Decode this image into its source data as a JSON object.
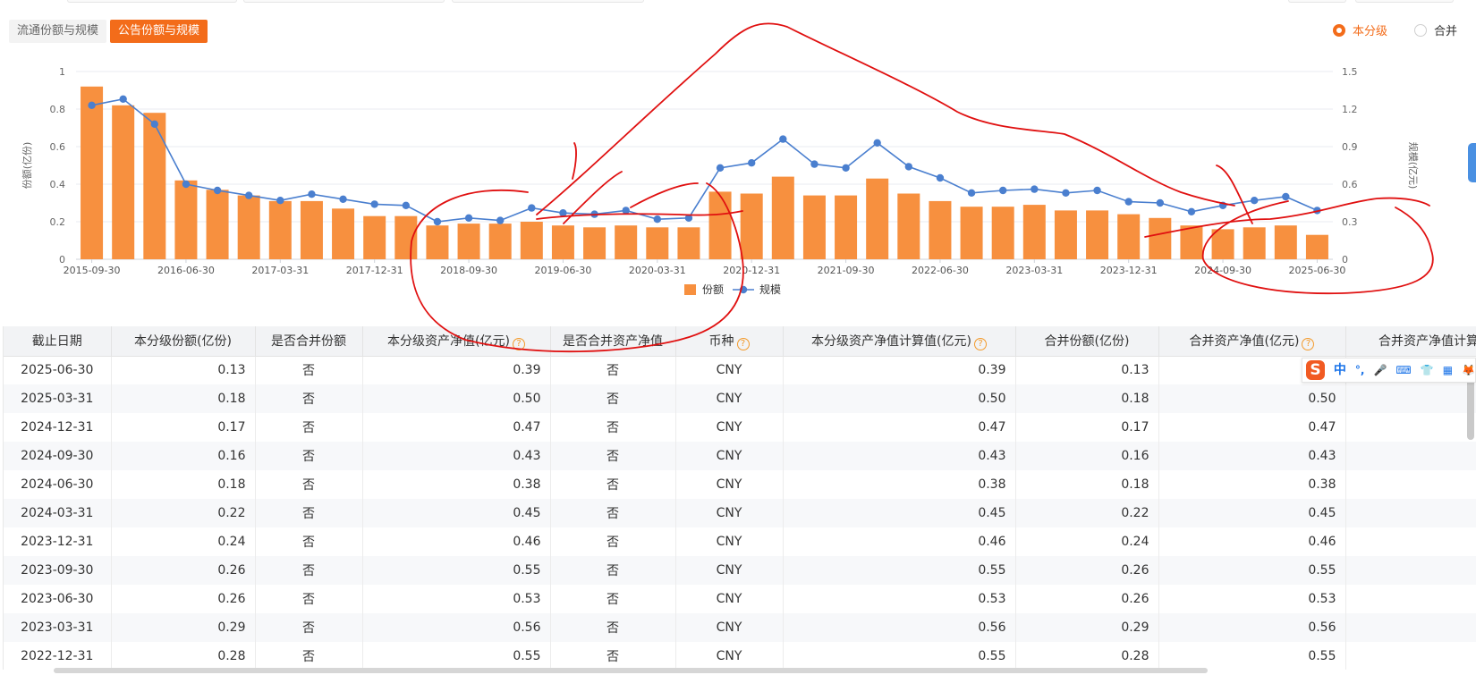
{
  "tabs": [
    {
      "label": "流通份额与规模",
      "active": false
    },
    {
      "label": "公告份额与规模",
      "active": true
    }
  ],
  "radios": [
    {
      "label": "本分级",
      "checked": true
    },
    {
      "label": "合并",
      "checked": false
    }
  ],
  "colors": {
    "accent": "#f36c1a",
    "bar": "#f7903f",
    "line": "#4a7fcf",
    "annotation": "#e01010"
  },
  "chart_data": {
    "type": "bar",
    "title": "",
    "ylabel": "份额(亿份)",
    "y2label": "规模(亿元)",
    "ylim": [
      0,
      1
    ],
    "y2lim": [
      0,
      1.5
    ],
    "yticks": [
      "0",
      "0.2",
      "0.4",
      "0.6",
      "0.8",
      "1"
    ],
    "y2ticks": [
      "0",
      "0.3",
      "0.6",
      "0.9",
      "1.2",
      "1.5"
    ],
    "xtick_labels": [
      "2015-09-30",
      "2016-06-30",
      "2017-03-31",
      "2017-12-31",
      "2018-09-30",
      "2019-06-30",
      "2020-03-31",
      "2020-12-31",
      "2021-09-30",
      "2022-06-30",
      "2023-03-31",
      "2023-12-31",
      "2024-09-30",
      "2025-06-30"
    ],
    "legend_position": "bottom",
    "categories": [
      "2015-09-30",
      "2015-12-31",
      "2016-03-31",
      "2016-06-30",
      "2016-09-30",
      "2016-12-31",
      "2017-03-31",
      "2017-06-30",
      "2017-09-30",
      "2017-12-31",
      "2018-03-31",
      "2018-06-30",
      "2018-09-30",
      "2018-12-31",
      "2019-03-31",
      "2019-06-30",
      "2019-09-30",
      "2019-12-31",
      "2020-03-31",
      "2020-06-30",
      "2020-09-30",
      "2020-12-31",
      "2021-03-31",
      "2021-06-30",
      "2021-09-30",
      "2021-12-31",
      "2022-03-31",
      "2022-06-30",
      "2022-09-30",
      "2022-12-31",
      "2023-03-31",
      "2023-06-30",
      "2023-09-30",
      "2023-12-31",
      "2024-03-31",
      "2024-06-30",
      "2024-09-30",
      "2024-12-31",
      "2025-03-31",
      "2025-06-30"
    ],
    "series": [
      {
        "name": "份额",
        "type": "bar",
        "axis": "left",
        "values": [
          0.92,
          0.82,
          0.78,
          0.42,
          0.37,
          0.34,
          0.31,
          0.31,
          0.27,
          0.23,
          0.23,
          0.18,
          0.19,
          0.19,
          0.2,
          0.18,
          0.17,
          0.18,
          0.17,
          0.17,
          0.36,
          0.35,
          0.44,
          0.34,
          0.34,
          0.43,
          0.35,
          0.31,
          0.28,
          0.28,
          0.29,
          0.26,
          0.26,
          0.24,
          0.22,
          0.18,
          0.16,
          0.17,
          0.18,
          0.13
        ]
      },
      {
        "name": "规模",
        "type": "line",
        "axis": "right",
        "values": [
          1.23,
          1.28,
          1.08,
          0.6,
          0.55,
          0.51,
          0.47,
          0.52,
          0.48,
          0.44,
          0.43,
          0.3,
          0.33,
          0.31,
          0.41,
          0.37,
          0.36,
          0.39,
          0.32,
          0.33,
          0.73,
          0.77,
          0.96,
          0.76,
          0.73,
          0.93,
          0.74,
          0.65,
          0.53,
          0.55,
          0.56,
          0.53,
          0.55,
          0.46,
          0.45,
          0.38,
          0.43,
          0.47,
          0.5,
          0.39
        ]
      }
    ]
  },
  "table": {
    "columns": [
      {
        "label": "截止日期",
        "help": false
      },
      {
        "label": "本分级份额(亿份)",
        "help": false
      },
      {
        "label": "是否合并份额",
        "help": false
      },
      {
        "label": "本分级资产净值(亿元)",
        "help": true
      },
      {
        "label": "是否合并资产净值",
        "help": false
      },
      {
        "label": "币种",
        "help": true
      },
      {
        "label": "本分级资产净值计算值(亿元)",
        "help": true
      },
      {
        "label": "合并份额(亿份)",
        "help": false
      },
      {
        "label": "合并资产净值(亿元)",
        "help": true
      },
      {
        "label": "合并资产净值计算值",
        "help": false
      }
    ],
    "rows": [
      [
        "2025-06-30",
        "0.13",
        "否",
        "0.39",
        "否",
        "CNY",
        "0.39",
        "0.13",
        "",
        ""
      ],
      [
        "2025-03-31",
        "0.18",
        "否",
        "0.50",
        "否",
        "CNY",
        "0.50",
        "0.18",
        "0.50",
        ""
      ],
      [
        "2024-12-31",
        "0.17",
        "否",
        "0.47",
        "否",
        "CNY",
        "0.47",
        "0.17",
        "0.47",
        ""
      ],
      [
        "2024-09-30",
        "0.16",
        "否",
        "0.43",
        "否",
        "CNY",
        "0.43",
        "0.16",
        "0.43",
        ""
      ],
      [
        "2024-06-30",
        "0.18",
        "否",
        "0.38",
        "否",
        "CNY",
        "0.38",
        "0.18",
        "0.38",
        ""
      ],
      [
        "2024-03-31",
        "0.22",
        "否",
        "0.45",
        "否",
        "CNY",
        "0.45",
        "0.22",
        "0.45",
        ""
      ],
      [
        "2023-12-31",
        "0.24",
        "否",
        "0.46",
        "否",
        "CNY",
        "0.46",
        "0.24",
        "0.46",
        ""
      ],
      [
        "2023-09-30",
        "0.26",
        "否",
        "0.55",
        "否",
        "CNY",
        "0.55",
        "0.26",
        "0.55",
        ""
      ],
      [
        "2023-06-30",
        "0.26",
        "否",
        "0.53",
        "否",
        "CNY",
        "0.53",
        "0.26",
        "0.53",
        ""
      ],
      [
        "2023-03-31",
        "0.29",
        "否",
        "0.56",
        "否",
        "CNY",
        "0.56",
        "0.29",
        "0.56",
        ""
      ],
      [
        "2022-12-31",
        "0.28",
        "否",
        "0.55",
        "否",
        "CNY",
        "0.55",
        "0.28",
        "0.55",
        ""
      ]
    ]
  },
  "ime_toolbar": {
    "logo": "S",
    "items": [
      {
        "icon": "chinese-mode-icon",
        "glyph": "中"
      },
      {
        "icon": "punctuation-icon",
        "glyph": "°,"
      },
      {
        "icon": "microphone-icon",
        "glyph": "🎤"
      },
      {
        "icon": "keyboard-icon",
        "glyph": "⌨"
      },
      {
        "icon": "skin-icon",
        "glyph": "👕"
      },
      {
        "icon": "toolbox-icon",
        "glyph": "▦"
      },
      {
        "icon": "more-icon",
        "glyph": "🦊"
      }
    ]
  }
}
